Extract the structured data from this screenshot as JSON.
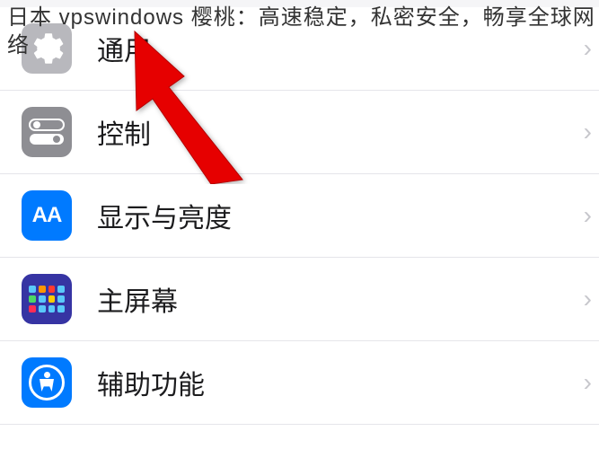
{
  "overlay": {
    "text": "日本 vpswindows 樱桃：高速稳定，私密安全，畅享全球网络"
  },
  "settings": {
    "items": [
      {
        "label": "通用",
        "icon": "gear"
      },
      {
        "label": "控制",
        "icon": "toggle"
      },
      {
        "label": "显示与亮度",
        "icon": "aa"
      },
      {
        "label": "主屏幕",
        "icon": "grid"
      },
      {
        "label": "辅助功能",
        "icon": "accessibility"
      }
    ]
  },
  "colors": {
    "blue": "#007aff",
    "gray": "#8e8e93",
    "lightGray": "#b8b8bd",
    "indigo": "#3634a3",
    "arrowRed": "#e60000"
  }
}
